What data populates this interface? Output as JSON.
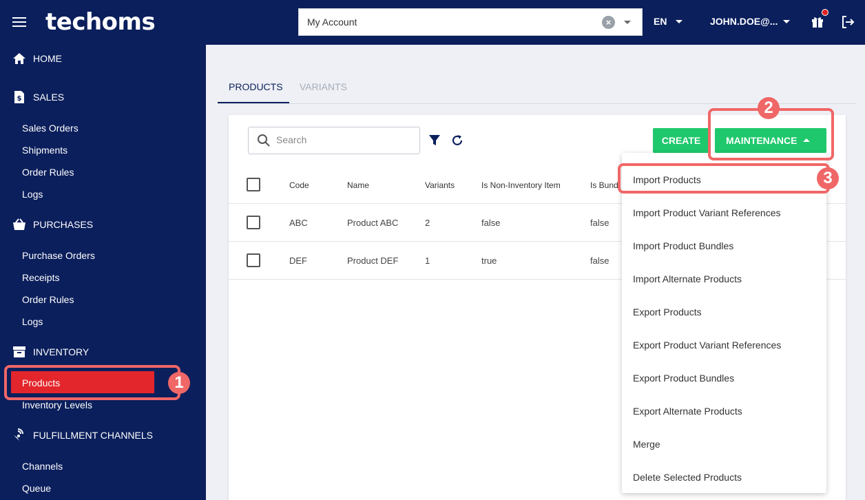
{
  "header": {
    "logo_text": "techoms",
    "account_value": "My Account",
    "language": "EN",
    "user": "JOHN.DOE@..."
  },
  "sidebar": {
    "home": "HOME",
    "sales": {
      "label": "SALES",
      "items": [
        "Sales Orders",
        "Shipments",
        "Order Rules",
        "Logs"
      ]
    },
    "purchases": {
      "label": "PURCHASES",
      "items": [
        "Purchase Orders",
        "Receipts",
        "Order Rules",
        "Logs"
      ]
    },
    "inventory": {
      "label": "INVENTORY",
      "items": [
        "Products",
        "Inventory Levels"
      ]
    },
    "fulfillment": {
      "label": "FULFILLMENT CHANNELS",
      "items": [
        "Channels",
        "Queue"
      ]
    }
  },
  "tabs": [
    "PRODUCTS",
    "VARIANTS"
  ],
  "toolbar": {
    "search_placeholder": "Search",
    "create_label": "CREATE",
    "maintenance_label": "MAINTENANCE"
  },
  "table": {
    "headers": [
      "Code",
      "Name",
      "Variants",
      "Is Non-Inventory Item",
      "Is Bund"
    ],
    "rows": [
      [
        "ABC",
        "Product ABC",
        "2",
        "false",
        "false"
      ],
      [
        "DEF",
        "Product DEF",
        "1",
        "true",
        "false"
      ]
    ]
  },
  "maintenance_menu": [
    "Import Products",
    "Import Product Variant References",
    "Import Product Bundles",
    "Import Alternate Products",
    "Export Products",
    "Export Product Variant References",
    "Export Product Bundles",
    "Export Alternate Products",
    "Merge",
    "Delete Selected Products"
  ],
  "annotations": [
    "1",
    "2",
    "3"
  ],
  "colors": {
    "navy": "#0b1f5c",
    "active_red": "#e3262b",
    "green": "#1fc86c",
    "highlight": "#f06767"
  }
}
